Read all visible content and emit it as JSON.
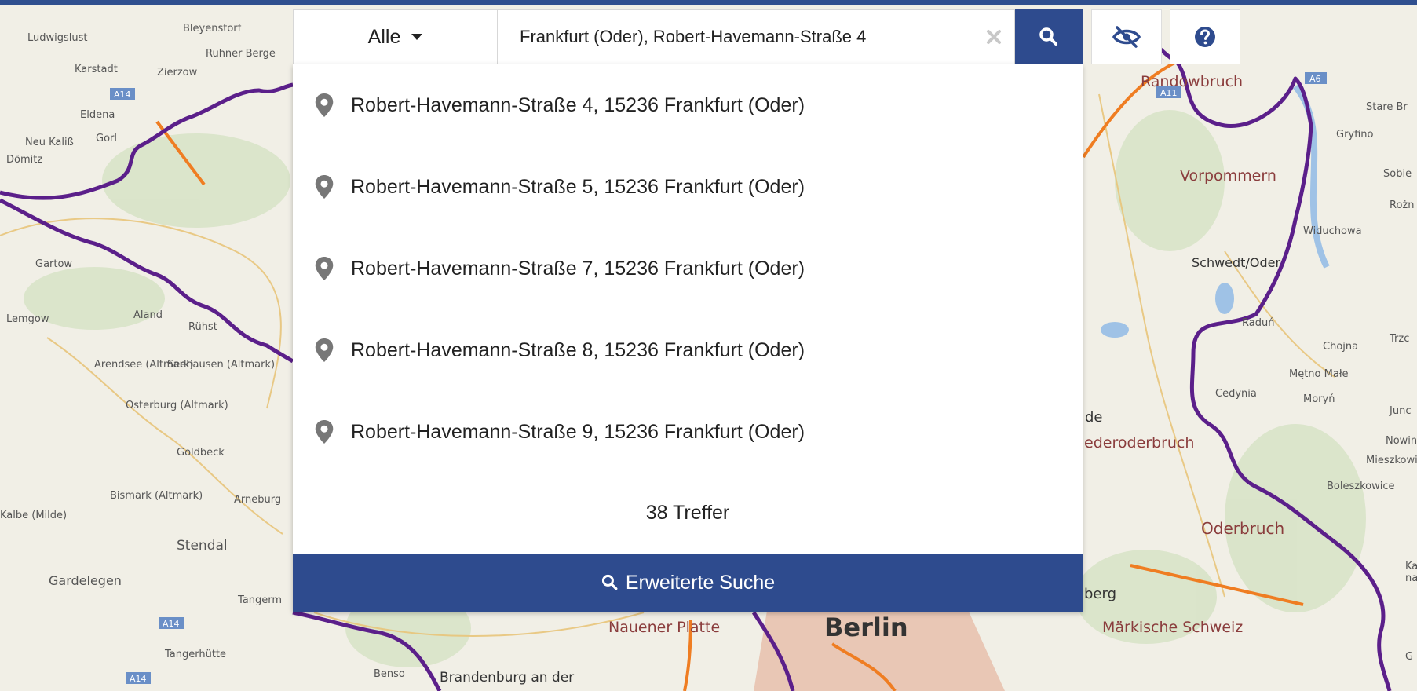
{
  "colors": {
    "accent": "#2e4b8e",
    "border_line": "#5b1f8a",
    "city_fill": "#e9c7b5"
  },
  "search": {
    "filter_label": "Alle",
    "value": "Frankfurt (Oder), Robert-Havemann-Straße 4"
  },
  "icons": {
    "filter": "chevron-down-icon",
    "clear": "close-icon",
    "search": "search-icon",
    "visibility": "eye-slash-icon",
    "help": "question-circle-icon",
    "result": "map-pin-icon"
  },
  "results": [
    "Robert-Havemann-Straße 4, 15236 Frankfurt (Oder)",
    "Robert-Havemann-Straße 5, 15236 Frankfurt (Oder)",
    "Robert-Havemann-Straße 7, 15236 Frankfurt (Oder)",
    "Robert-Havemann-Straße 8, 15236 Frankfurt (Oder)",
    "Robert-Havemann-Straße 9, 15236 Frankfurt (Oder)"
  ],
  "hits_label": "38 Treffer",
  "advanced_search_label": "Erweiterte Suche",
  "map": {
    "places": [
      "Ludwigslust",
      "Bleyenstorf",
      "Ruhner Berge",
      "Karstadt",
      "Zierzow",
      "Eldena",
      "Neu Kaliß",
      "Gorl",
      "Dömitz",
      "Gartow",
      "Lemgow",
      "Aland",
      "Rühst",
      "Arendsee (Altmark)",
      "Seehausen (Altmark)",
      "Osterburg (Altmark)",
      "Goldbeck",
      "Bismark (Altmark)",
      "Arneburg",
      "Kalbe (Milde)",
      "Stendal",
      "Gardelegen",
      "Tangerm",
      "Tangerhütte",
      "Benso",
      "Brandenburg an der",
      "Randowbruch",
      "Stare Br",
      "Gryfino",
      "Vorpommern",
      "Sobie",
      "Rożn",
      "Widuchowa",
      "Schwedt/Oder",
      "Raduń",
      "Chojna",
      "Trzc",
      "Mętno Małe",
      "Cedynia",
      "Moryń",
      "Junc",
      "Nowin",
      "Mieszkowic",
      "Boleszkowice",
      "Oderbruch",
      "de",
      "ederoderbruch",
      "berg",
      "Märkische Schweiz",
      "Nauener Platte",
      "Berlin",
      "Ka",
      "na",
      "G"
    ],
    "road_shields": [
      "A14",
      "A14",
      "A14",
      "A11",
      "A6"
    ]
  }
}
